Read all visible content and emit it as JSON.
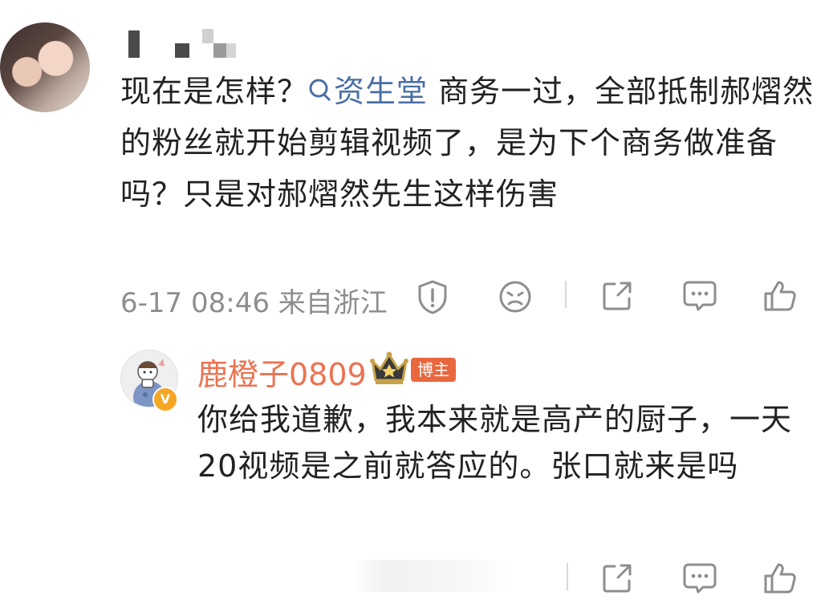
{
  "comment": {
    "text_before": "现在是怎样？",
    "topic_icon": "search-icon",
    "topic": "资生堂",
    "text_after": " 商务一过，全部抵制郝熠然的粉丝就开始剪辑视频了，是为下个商务做准备吗？只是对郝熠然先生这样伤害",
    "time": "6-17 08:46",
    "location": "来自浙江",
    "actions": [
      "report-icon",
      "dislike-icon",
      "share-icon",
      "comment-icon",
      "like-icon"
    ]
  },
  "reply": {
    "username": "鹿橙子0809",
    "badge": "博主",
    "text": "你给我道歉，我本来就是高产的厨子，一天20视频是之前就答应的。张口就来是吗",
    "actions": [
      "share-icon",
      "comment-icon",
      "like-icon"
    ]
  },
  "colors": {
    "link": "#4a6fa5",
    "username_reply": "#eb7350",
    "meta": "#8e8e8e",
    "badge_bg": "#e9673f"
  }
}
